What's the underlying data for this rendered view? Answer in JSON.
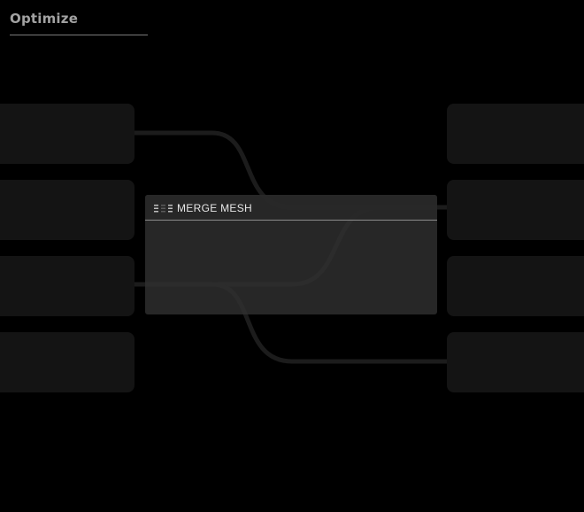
{
  "panel": {
    "title": "Optimize"
  },
  "node": {
    "title": "MERGE MESH",
    "icon": "mesh-stack-icon"
  },
  "colors": {
    "background": "#000000",
    "slot": "#141414",
    "node": "#303030",
    "wire": "#1c1c1c",
    "title_text": "#a2a2a2",
    "node_text": "#e6e6e6"
  }
}
